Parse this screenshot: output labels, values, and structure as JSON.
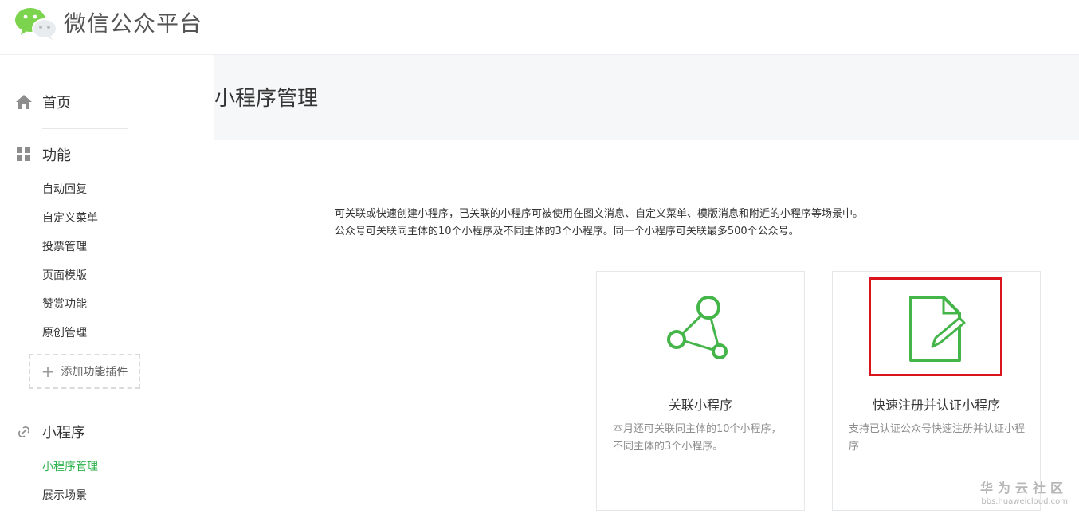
{
  "header": {
    "title": "微信公众平台",
    "logo_icon": "wechat-logo-icon",
    "accent_color": "#7bd34e"
  },
  "sidebar": {
    "home": {
      "label": "首页",
      "icon": "home-icon"
    },
    "features": {
      "label": "功能",
      "icon": "grid-icon",
      "items": [
        "自动回复",
        "自定义菜单",
        "投票管理",
        "页面模版",
        "赞赏功能",
        "原创管理"
      ],
      "add_plugin": "添加功能插件"
    },
    "miniprogram": {
      "label": "小程序",
      "icon": "link-icon",
      "items": [
        "小程序管理",
        "展示场景"
      ],
      "active_item": "小程序管理"
    }
  },
  "main": {
    "title": "小程序管理",
    "description": [
      "可关联或快速创建小程序，已关联的小程序可被使用在图文消息、自定义菜单、模版消息和附近的小程序等场景中。",
      "公众号可关联同主体的10个小程序及不同主体的3个小程序。同一个小程序可关联最多500个公众号。"
    ],
    "cards": [
      {
        "title": "关联小程序",
        "description": "本月还可关联同主体的10个小程序，不同主体的3个小程序。",
        "icon": "link-nodes-icon"
      },
      {
        "title": "快速注册并认证小程序",
        "description": "支持已认证公众号快速注册并认证小程序",
        "icon": "document-pen-icon"
      }
    ],
    "icon_color": "#44b549",
    "highlight_color": "#d9141b"
  },
  "watermark": {
    "line1": "华为云社区",
    "line2": "bbs.huaweicloud.com"
  }
}
